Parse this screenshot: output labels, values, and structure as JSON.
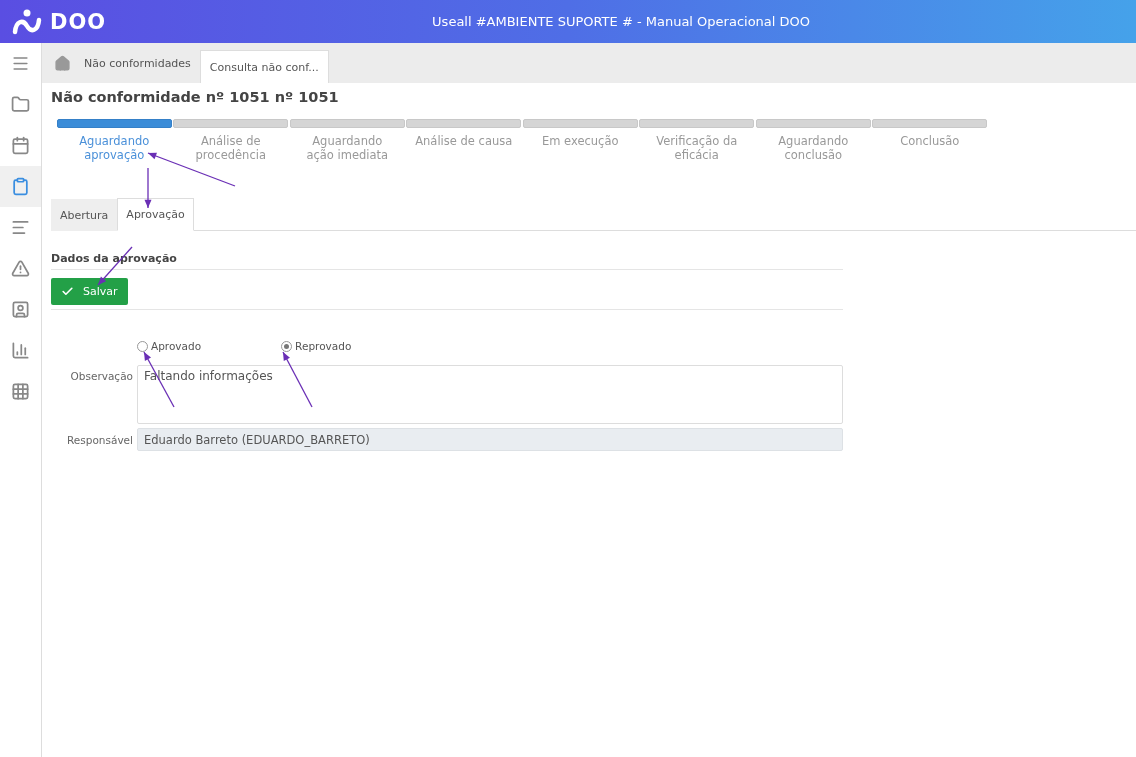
{
  "header": {
    "logo": "DOO",
    "title": "Useall #AMBIENTE SUPORTE # - Manual Operacional DOO"
  },
  "sidebar": {
    "items": [
      {
        "kind": "menu",
        "selected": false
      },
      {
        "kind": "folder",
        "selected": false
      },
      {
        "kind": "calendar",
        "selected": false
      },
      {
        "kind": "clipboard",
        "selected": true
      },
      {
        "kind": "lines",
        "selected": false
      },
      {
        "kind": "warning",
        "selected": false
      },
      {
        "kind": "contact",
        "selected": false
      },
      {
        "kind": "chart",
        "selected": false
      },
      {
        "kind": "grid",
        "selected": false
      }
    ]
  },
  "tabs": [
    {
      "label": "Não conformidades",
      "selected": false
    },
    {
      "label": "Consulta não conf...",
      "selected": true
    }
  ],
  "page_title": "Não conformidade nº 1051 nº 1051",
  "steps": [
    {
      "label": "Aguardando aprovação",
      "selected": true
    },
    {
      "label": "Análise de procedência",
      "selected": false
    },
    {
      "label": "Aguardando ação imediata",
      "selected": false
    },
    {
      "label": "Análise de causa",
      "selected": false
    },
    {
      "label": "Em execução",
      "selected": false
    },
    {
      "label": "Verificação da eficácia",
      "selected": false
    },
    {
      "label": "Aguardando conclusão",
      "selected": false
    },
    {
      "label": "Conclusão",
      "selected": false
    }
  ],
  "inner_tabs": [
    {
      "label": "Abertura",
      "selected": false
    },
    {
      "label": "Aprovação",
      "selected": true
    }
  ],
  "section_title": "Dados da aprovação",
  "save_button": "Salvar",
  "decision": [
    {
      "label": "Aprovado",
      "selected": false
    },
    {
      "label": "Reprovado",
      "selected": true
    }
  ],
  "fields": [
    {
      "label": "Observação",
      "value": "Faltando informações",
      "kind": "textarea"
    },
    {
      "label": "Responsável",
      "value": "Eduardo Barreto  (EDUARDO_BARRETO)",
      "kind": "readonly"
    }
  ]
}
